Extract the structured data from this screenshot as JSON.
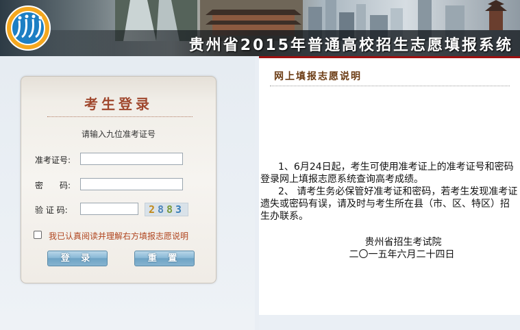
{
  "header": {
    "title": "贵州省2015年普通高校招生志愿填报系统"
  },
  "login": {
    "heading": "考生登录",
    "hint": "请输入九位准考证号",
    "ticket_label": "准考证号:",
    "ticket_value": "",
    "password_label": "密　　码:",
    "password_value": "",
    "captcha_label": "验 证 码:",
    "captcha_value": "",
    "captcha_chars": [
      "2",
      "8",
      "8",
      "3"
    ],
    "agree_text": "我已认真阅读并理解右方填报志愿说明",
    "agree_checked": false,
    "login_button": "登 录",
    "reset_button": "重 置"
  },
  "notice": {
    "title": "网上填报志愿说明",
    "paragraphs": [
      "1、6月24日起，考生可使用准考证上的准考证号和密码登录网上填报志愿系统查询高考成绩。",
      "2、 请考生务必保管好准考证和密码，若考生发现准考证遗失或密码有误，请及时与考生所在县（市、区、特区）招生办联系。"
    ],
    "signature_org": "贵州省招生考试院",
    "signature_date": "二〇一五年六月二十四日"
  },
  "colors": {
    "accent_red": "#9d0f0f",
    "login_title": "#a0482e",
    "button_blue": "#6ea3c5"
  }
}
